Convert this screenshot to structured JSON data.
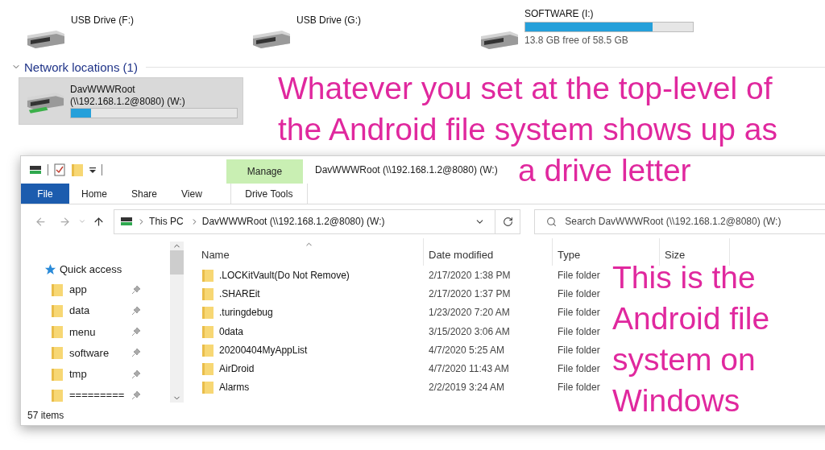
{
  "drives": [
    {
      "kind": "plain",
      "label": "USB Drive (F:)"
    },
    {
      "kind": "plain",
      "label": "USB Drive (G:)"
    },
    {
      "kind": "meter",
      "label": "SOFTWARE (I:)",
      "level": 0.76,
      "free": "13.8 GB free of 58.5 GB"
    }
  ],
  "network_section": {
    "title": "Network locations (1)",
    "expanded": true
  },
  "network_drives": [
    {
      "name": "DavWWWRoot",
      "path": "(\\\\192.168.1.2@8080) (W:)",
      "selected": true,
      "level": 0.12
    }
  ],
  "annotations": [
    {
      "lines": [
        "Whatever you set at the top-level of",
        "the Android file system shows up as",
        "a drive letter"
      ],
      "color": "#e0289e"
    },
    {
      "lines": [
        "This is the",
        "Android file",
        "system on",
        "Windows"
      ],
      "color": "#e0289e"
    }
  ],
  "window": {
    "title": "DavWWWRoot (\\\\192.168.1.2@8080) (W:)",
    "ribbon_tabs": [
      {
        "kind": "file",
        "label": "File"
      },
      {
        "kind": "tab",
        "label": "Home"
      },
      {
        "kind": "tab",
        "label": "Share"
      },
      {
        "kind": "tab",
        "label": "View"
      },
      {
        "kind": "contextual",
        "group": "Manage",
        "label": "Drive Tools"
      }
    ],
    "address": {
      "crumbs": [
        "This PC",
        "DavWWWRoot (\\\\192.168.1.2@8080) (W:)"
      ]
    },
    "search": {
      "placeholder": "Search DavWWWRoot (\\\\192.168.1.2@8080) (W:)"
    },
    "nav": {
      "title": "Quick access",
      "items": [
        {
          "label": "app",
          "pinned": true
        },
        {
          "label": "data",
          "pinned": true
        },
        {
          "label": "menu",
          "pinned": true
        },
        {
          "label": "software",
          "pinned": true
        },
        {
          "label": "tmp",
          "pinned": true
        },
        {
          "label": "=========",
          "pinned": true
        }
      ]
    },
    "table": {
      "columns": [
        "Name",
        "Date modified",
        "Type",
        "Size"
      ],
      "rows": [
        {
          "name": ".LOCKitVault(Do Not Remove)",
          "date": "2/17/2020 1:38 PM",
          "type": "File folder"
        },
        {
          "name": ".SHAREit",
          "date": "2/17/2020 1:37 PM",
          "type": "File folder"
        },
        {
          "name": ".turingdebug",
          "date": "1/23/2020 7:20 AM",
          "type": "File folder"
        },
        {
          "name": "0data",
          "date": "3/15/2020 3:06 AM",
          "type": "File folder"
        },
        {
          "name": "20200404MyAppList",
          "date": "4/7/2020 5:25 AM",
          "type": "File folder"
        },
        {
          "name": "AirDroid",
          "date": "4/7/2020 11:43 AM",
          "type": "File folder"
        },
        {
          "name": "Alarms",
          "date": "2/2/2019 3:24 AM",
          "type": "File folder"
        }
      ]
    },
    "status_bar": "57 items"
  }
}
